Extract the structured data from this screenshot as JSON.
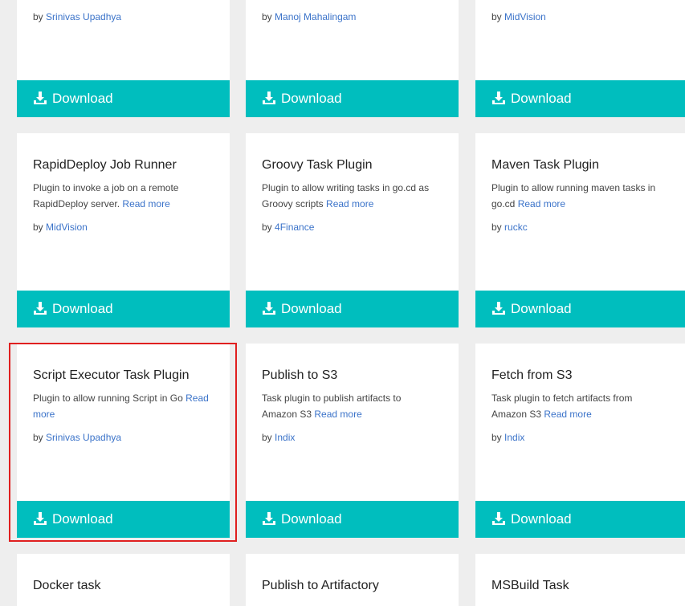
{
  "download_label": "Download",
  "by": "by",
  "read_more": "Read more",
  "row1": [
    {
      "author": "Srinivas Upadhya"
    },
    {
      "author": "Manoj Mahalingam"
    },
    {
      "author": "MidVision"
    }
  ],
  "row2": [
    {
      "title": "RapidDeploy Job Runner",
      "desc": "Plugin to invoke a job on a remote RapidDeploy server.",
      "author": "MidVision"
    },
    {
      "title": "Groovy Task Plugin",
      "desc": "Plugin to allow writing tasks in go.cd as Groovy scripts",
      "author": "4Finance"
    },
    {
      "title": "Maven Task Plugin",
      "desc": "Plugin to allow running maven tasks in go.cd",
      "author": "ruckc"
    }
  ],
  "row3": [
    {
      "title": "Script Executor Task Plugin",
      "desc": "Plugin to allow running Script in Go",
      "author": "Srinivas Upadhya"
    },
    {
      "title": "Publish to S3",
      "desc": "Task plugin to publish artifacts to Amazon S3",
      "author": "Indix"
    },
    {
      "title": "Fetch from S3",
      "desc": "Task plugin to fetch artifacts from Amazon S3",
      "author": "Indix"
    }
  ],
  "row4": [
    {
      "title": "Docker task"
    },
    {
      "title": "Publish to Artifactory"
    },
    {
      "title": "MSBuild Task"
    }
  ],
  "icons": {
    "download": "download-icon"
  },
  "colors": {
    "accent": "#00bebe",
    "link": "#3b73c9",
    "highlight": "#e02020"
  }
}
